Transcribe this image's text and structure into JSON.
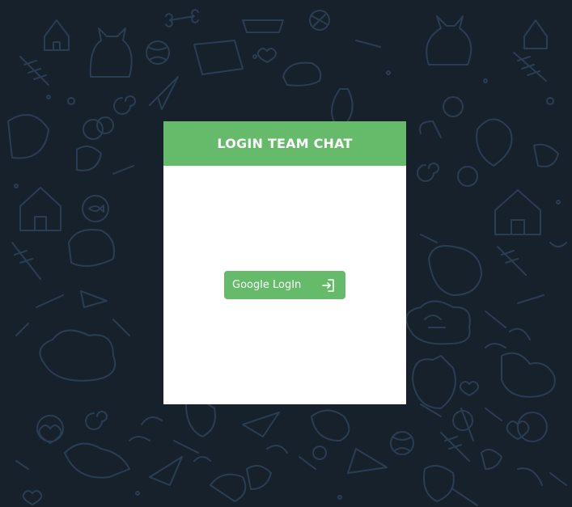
{
  "app": {
    "title": "LOGIN TEAM CHAT"
  },
  "login": {
    "button_label": "Google LogIn",
    "button_icon": "login-icon"
  },
  "colors": {
    "accent": "#66bb6a",
    "background": "#17212b",
    "card": "#ffffff",
    "pattern": "#2a3b4f"
  }
}
